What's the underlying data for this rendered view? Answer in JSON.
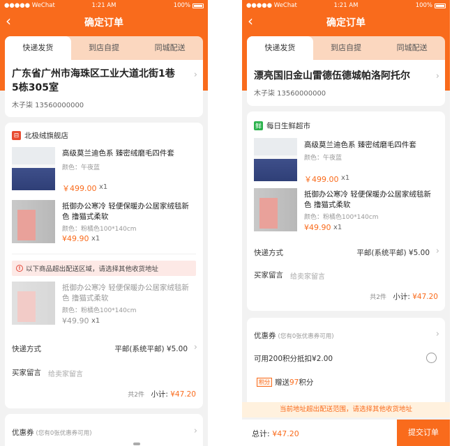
{
  "status": {
    "carrier": "●●●●● WeChat",
    "time": "1:21 AM",
    "battery": "100%"
  },
  "nav": {
    "title": "确定订单"
  },
  "tabs": [
    "快递发货",
    "到店自提",
    "同城配送"
  ],
  "colors": {
    "accent": "#f96b1c",
    "warn_bg": "#fde9e6",
    "notice_bg": "#fff1de"
  },
  "screen_a": {
    "address": {
      "line1": "广东省广州市海珠区工业大道北街1巷",
      "line2": "5栋305室",
      "contact": "木子柒 13560000000"
    },
    "store": {
      "name": "北极绒旗舰店",
      "icon": "shop-icon"
    },
    "products": [
      {
        "name_line1": "高级莫兰迪色系 臻密绒磨毛四件套",
        "name_line2": "",
        "spec": "颜色：午夜蓝",
        "price": "￥499.00",
        "qty": "x1"
      },
      {
        "name_line1": "抵御办公寒冷 轻便保暖办公居家绒毯新",
        "name_line2": "色 撸猫式柔软",
        "spec": "颜色：粉橘色100*140cm",
        "price": "¥49.90",
        "qty": "x1"
      }
    ],
    "warning": "以下商品超出配送区域，请选择其他收货地址",
    "unavailable": {
      "name_line1": "抵御办公寒冷 轻便保暖办公居家绒毯新",
      "name_line2": "色 撸猫式柔软",
      "spec": "颜色：粉橘色100*140cm",
      "price": "¥49.90",
      "qty": "x1"
    },
    "shipping": {
      "label": "快递方式",
      "value": "平邮(系统平邮) ¥5.00"
    },
    "message": {
      "label": "买家留言",
      "placeholder": "给卖家留言"
    },
    "subtotal": {
      "count": "共2件",
      "label": "小计:",
      "amount": "¥47.20"
    },
    "coupon": {
      "label": "优惠券",
      "note": "(您有0张优惠券可用)"
    }
  },
  "screen_b": {
    "address": {
      "line1": "漂亮国旧金山雷德伍德城帕洛阿托尔",
      "contact": "木子柒 13560000000"
    },
    "store": {
      "name": "每日生鲜超市",
      "icon_char": "鲜"
    },
    "products": [
      {
        "name_line1": "高级莫兰迪色系 臻密绒磨毛四件套",
        "name_line2": "",
        "spec": "颜色：午夜蓝",
        "price": "￥499.00",
        "qty": "x1"
      },
      {
        "name_line1": "抵御办公寒冷 轻便保暖办公居家绒毯新",
        "name_line2": "色 撸猫式柔软",
        "spec": "颜色：粉橘色100*140cm",
        "price": "¥49.90",
        "qty": "x1"
      }
    ],
    "shipping": {
      "label": "快递方式",
      "value": "平邮(系统平邮) ¥5.00"
    },
    "message": {
      "label": "买家留言",
      "placeholder": "给卖家留言"
    },
    "subtotal": {
      "count": "共2件",
      "label": "小计:",
      "amount": "¥47.20"
    },
    "coupon": {
      "label": "优惠券",
      "note": "(您有0张优惠券可用)"
    },
    "points_deduct": "可用200积分抵扣¥2.00",
    "points_gift": {
      "badge": "积分",
      "prefix": "赠送",
      "number": "97",
      "suffix": "积分"
    },
    "notice": "当前地址超出配送范围，请选择其他收货地址",
    "total": {
      "label": "总计:",
      "amount": "¥47.20"
    },
    "submit": "提交订单"
  }
}
